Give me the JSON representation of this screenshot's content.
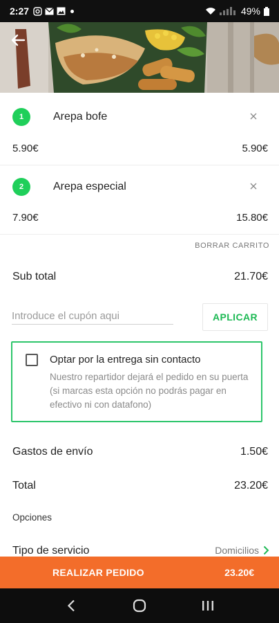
{
  "status_bar": {
    "time": "2:27",
    "battery": "49%"
  },
  "cart": {
    "items": [
      {
        "index": "1",
        "name": "Arepa bofe",
        "unit_price": "5.90€",
        "total": "5.90€"
      },
      {
        "index": "2",
        "name": "Arepa especial",
        "unit_price": "7.90€",
        "total": "15.80€"
      }
    ],
    "clear_cart_label": "BORRAR CARRITO",
    "subtotal_label": "Sub total",
    "subtotal_value": "21.70€"
  },
  "coupon": {
    "placeholder": "Introduce el cupón aqui",
    "apply_label": "APLICAR"
  },
  "contactless": {
    "title": "Optar por la entrega sin contacto",
    "description": "Nuestro repartidor dejará el pedido en su puerta (si marcas esta opción no podrás pagar en efectivo ni con datafono)"
  },
  "summary": {
    "shipping_label": "Gastos de envío",
    "shipping_value": "1.50€",
    "total_label": "Total",
    "total_value": "23.20€"
  },
  "options": {
    "heading": "Opciones",
    "service_type_label": "Tipo de servicio",
    "service_type_value": "Domicilios"
  },
  "order_button": {
    "label": "REALIZAR PEDIDO",
    "total": "23.20€"
  },
  "colors": {
    "accent_green": "#1fcf5a",
    "order_orange": "#f36d2a"
  }
}
